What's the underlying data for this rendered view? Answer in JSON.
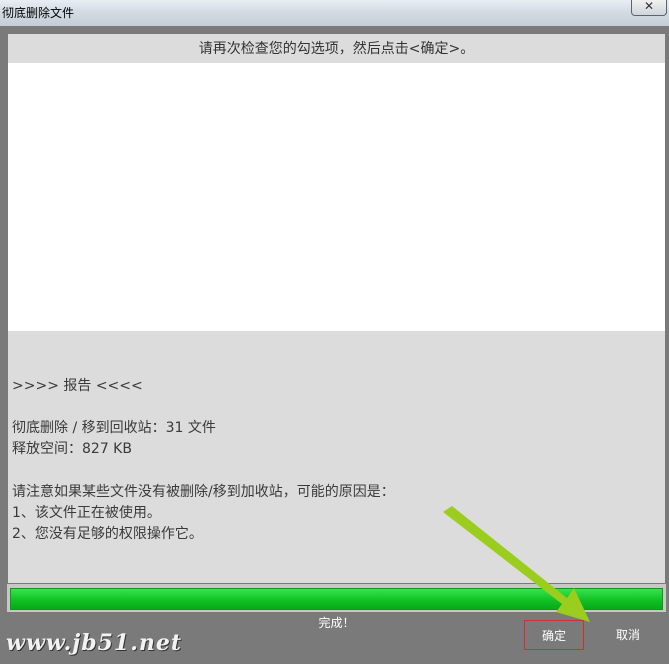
{
  "window": {
    "title": "彻底删除文件",
    "close_glyph": "✕"
  },
  "instruction": "请再次检查您的勾选项，然后点击<确定>。",
  "report": {
    "header": ">>>> 报告 <<<<",
    "deleted": "彻底删除 / 移到回收站：31 文件",
    "freed": "释放空间：827 KB",
    "note": "请注意如果某些文件没有被删除/移到加收站，可能的原因是：",
    "reason1": "1、该文件正在被使用。",
    "reason2": "2、您没有足够的权限操作它。"
  },
  "progress": {
    "value": 1.0,
    "fill_color": "#10c224"
  },
  "status": "完成！",
  "buttons": {
    "ok": "确定",
    "cancel": "取消"
  },
  "watermark": "www.jb51.net",
  "colors": {
    "highlight_border": "#d03030",
    "arrow": "#9acd1e"
  }
}
